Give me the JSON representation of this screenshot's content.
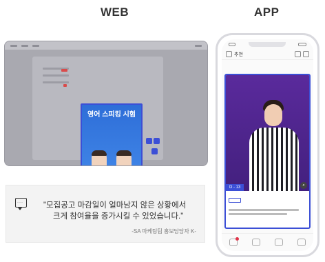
{
  "labels": {
    "web": "WEB",
    "app": "APP"
  },
  "web_mockup": {
    "popup": {
      "title": "영어 스피킹 시험"
    }
  },
  "quote": {
    "line1": "\"모집공고 마감일이 얼마남지 않은 상황에서",
    "line2": "크게 참여율을 증가시킬 수 있었습니다.\"",
    "source": "-SA 마케팅팀 홍보담당자 K-"
  },
  "phone_mockup": {
    "header_title": "추천",
    "popup": {
      "count_badge": "D - 13"
    }
  },
  "colors": {
    "highlight": "#3c4fd6",
    "poster_blue": "#2e6ed8",
    "poster_purple": "#5a2a9c"
  },
  "icons": [
    "speech-bubble-icon",
    "zoom-icon",
    "home-icon",
    "bell-icon",
    "user-icon",
    "menu-icon"
  ]
}
